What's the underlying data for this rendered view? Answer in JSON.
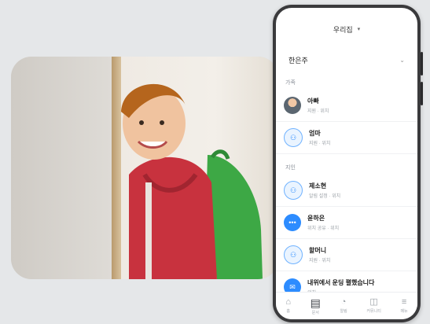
{
  "phone": {
    "header_title": "우리집",
    "selector_value": "한은주",
    "sections": [
      {
        "label": "가족",
        "contacts": [
          {
            "name": "아빠",
            "sub": "지원 · 위치",
            "avatar": "photo"
          },
          {
            "name": "엄마",
            "sub": "지원 · 위치",
            "avatar": "outline"
          }
        ]
      },
      {
        "label": "지인",
        "contacts": [
          {
            "name": "제소현",
            "sub": "알림 설정 · 위치",
            "avatar": "outline"
          },
          {
            "name": "윤하은",
            "sub": "위치 공유 · 위치",
            "avatar": "filled"
          },
          {
            "name": "할머니",
            "sub": "지원 · 위치",
            "avatar": "outline"
          },
          {
            "name": "내위에서 운딩 펼했습니다",
            "sub": "위치",
            "avatar": "filled"
          }
        ]
      }
    ],
    "tabs": [
      {
        "label": "홈",
        "icon": "home-icon"
      },
      {
        "label": "문서",
        "icon": "document-icon",
        "active": true
      },
      {
        "label": "알림",
        "icon": "bell-icon"
      },
      {
        "label": "커뮤니티",
        "icon": "chat-icon"
      },
      {
        "label": "메뉴",
        "icon": "menu-icon"
      }
    ]
  },
  "colors": {
    "background": "#e5e7e9",
    "accent": "#2d8cff"
  }
}
